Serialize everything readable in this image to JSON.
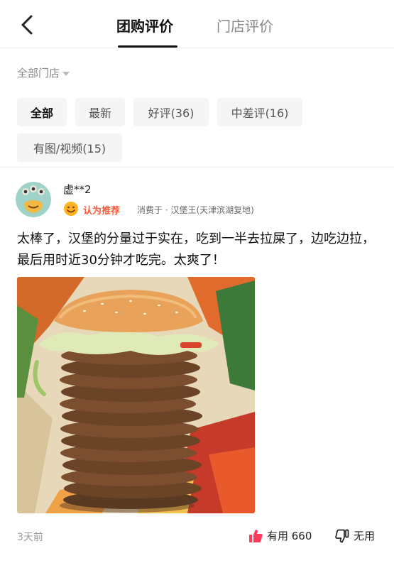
{
  "header": {
    "tabs": [
      {
        "label": "团购评价",
        "active": true
      },
      {
        "label": "门店评价",
        "active": false
      }
    ]
  },
  "store_filter": {
    "label": "全部门店"
  },
  "filters": [
    {
      "label": "全部",
      "active": true
    },
    {
      "label": "最新"
    },
    {
      "label": "好评(36)"
    },
    {
      "label": "中差评(16)"
    },
    {
      "label": "有图/视频(15)"
    }
  ],
  "review": {
    "username": "虚**2",
    "recommend": "认为推荐",
    "consumed": "消费于 · 汉堡王(天津滨湖复地)",
    "text": "太棒了，汉堡的分量过于实在，吃到一半去拉屎了，边吃边拉，最后用时近30分钟才吃完。太爽了！",
    "time": "3天前",
    "useful_label": "有用 660",
    "useless_label": "无用"
  },
  "colors": {
    "accent": "#ff5a3c",
    "useful_icon": "#ff3b5c"
  },
  "icons": {
    "back": "chevron-left-icon",
    "thumb_up": "thumb-up-icon",
    "thumb_down": "thumb-down-icon"
  }
}
